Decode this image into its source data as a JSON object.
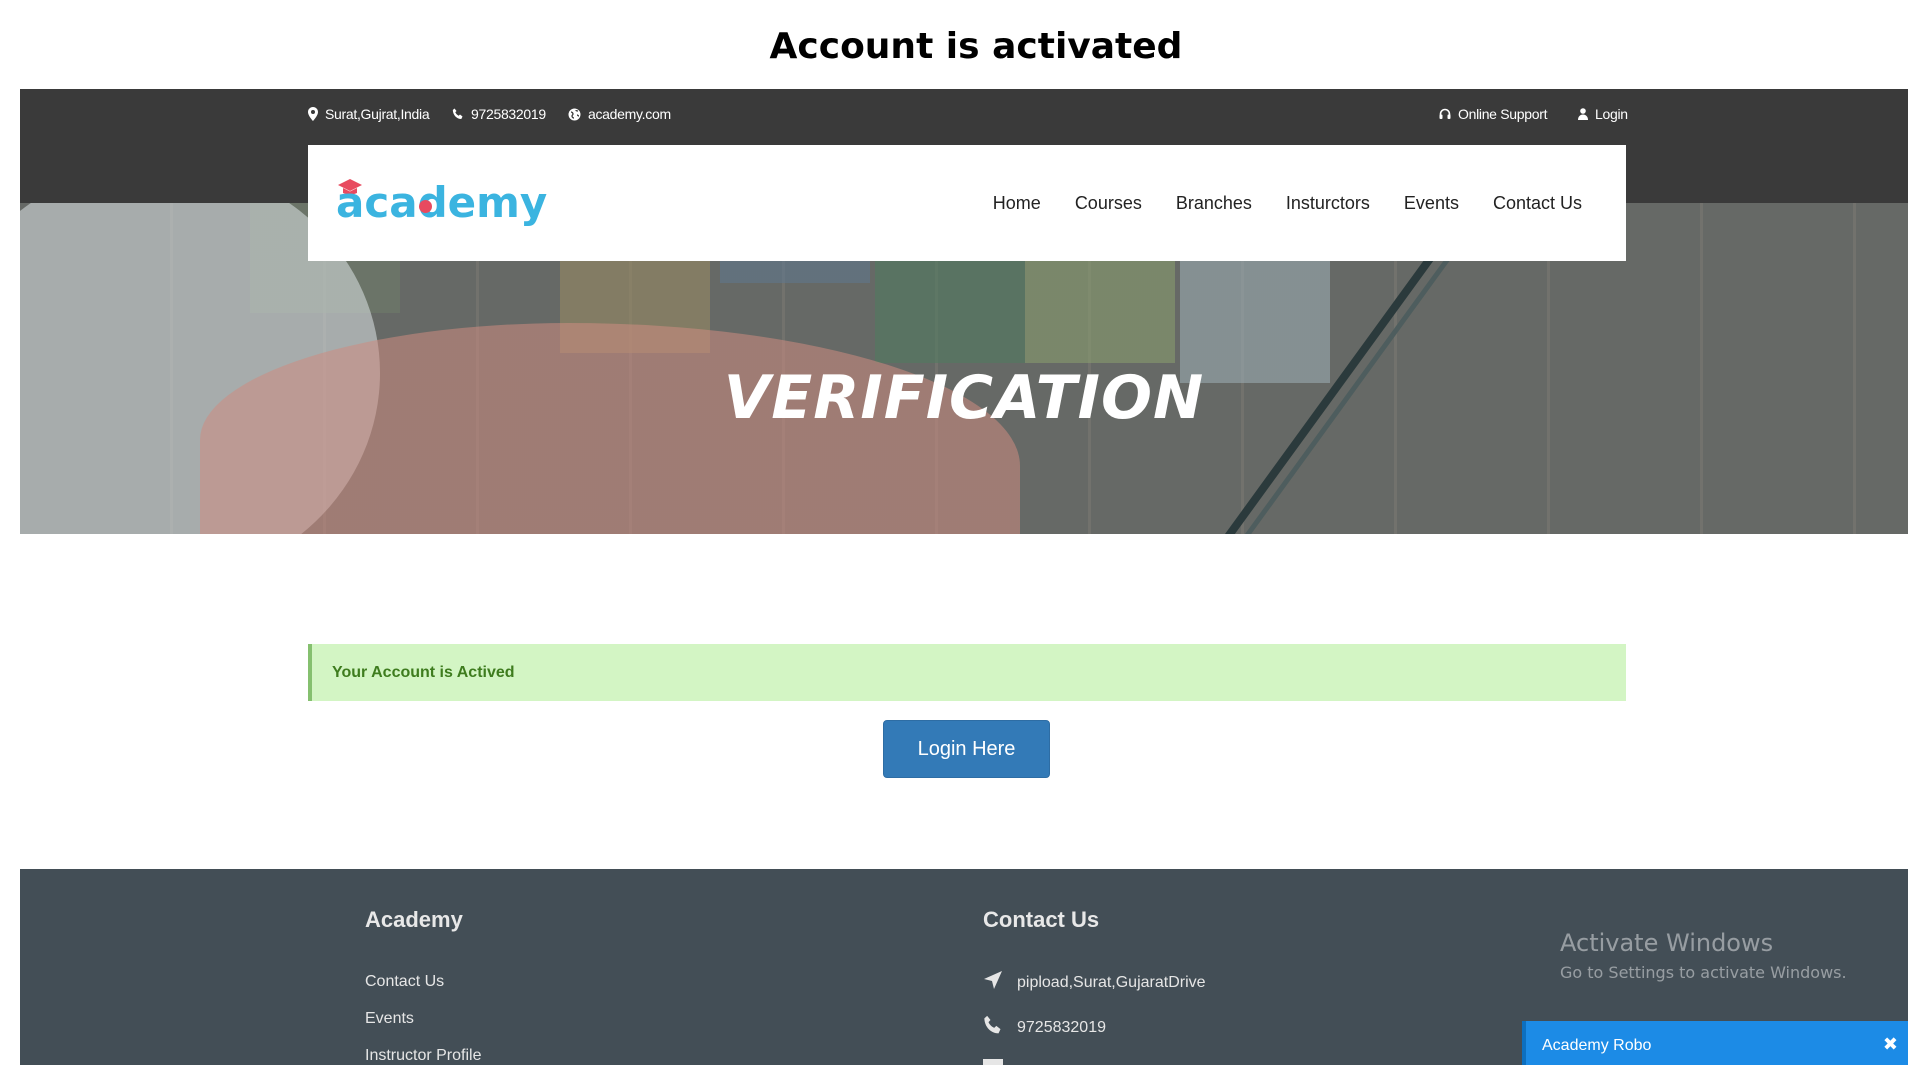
{
  "page_caption": "Account is activated",
  "topbar": {
    "location": "Surat,Gujrat,India",
    "phone": "9725832019",
    "website": "academy.com",
    "online_support": "Online Support",
    "login": "Login"
  },
  "logo": {
    "text": "academy"
  },
  "nav": {
    "items": [
      "Home",
      "Courses",
      "Branches",
      "Insturctors",
      "Events",
      "Contact Us"
    ]
  },
  "hero": {
    "title": "VERIFICATION"
  },
  "alert": {
    "message": "Your Account is Actived"
  },
  "login_button": {
    "label": "Login Here"
  },
  "footer": {
    "col1": {
      "heading": "Academy",
      "links": [
        "Contact Us",
        "Events",
        "Instructor Profile"
      ]
    },
    "col2": {
      "heading": "Contact Us",
      "address": "pipload,Surat,GujaratDrive",
      "phone": "9725832019"
    }
  },
  "windows_watermark": {
    "title": "Activate Windows",
    "subtitle": "Go to Settings to activate Windows."
  },
  "chat_widget": {
    "label": "Academy Robo",
    "close": "✖"
  },
  "colors": {
    "accent": "#337ab7",
    "alert_bg": "#d3f5c4",
    "alert_text": "#3e7c1e",
    "footer_bg": "#434e56",
    "topbar_bg": "#3a3a3a",
    "logo_blue": "#3bb4e0",
    "chat_blue": "#1c8be6"
  }
}
